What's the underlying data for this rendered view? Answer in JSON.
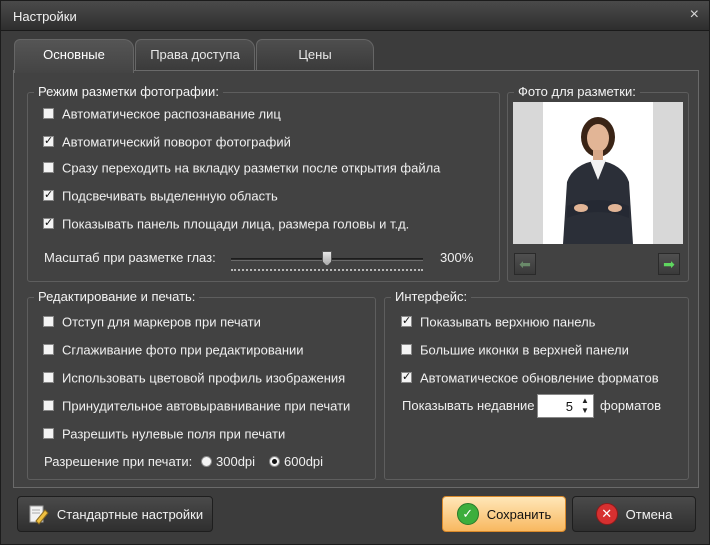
{
  "window": {
    "title": "Настройки",
    "close_glyph": "×"
  },
  "tabs": [
    {
      "label": "Основные",
      "active": true
    },
    {
      "label": "Права доступа",
      "active": false
    },
    {
      "label": "Цены",
      "active": false
    }
  ],
  "photo_markup": {
    "legend": "Режим разметки фотографии:",
    "options": [
      {
        "label": "Автоматическое распознавание лиц",
        "checked": false
      },
      {
        "label": "Автоматический поворот фотографий",
        "checked": true
      },
      {
        "label": "Сразу переходить на вкладку разметки после открытия файла",
        "checked": false
      },
      {
        "label": "Подсвечивать выделенную область",
        "checked": true
      },
      {
        "label": "Показывать панель площади лица, размера головы и т.д.",
        "checked": true
      }
    ],
    "scale_label": "Масштаб при разметке глаз:",
    "scale_value": "300%",
    "scale_level": 0.5
  },
  "photo_preview": {
    "legend": "Фото для разметки:",
    "prev_icon": "arrow-left-icon",
    "next_icon": "arrow-right-icon"
  },
  "editing": {
    "legend": "Редактирование и печать:",
    "options": [
      {
        "label": "Отступ для маркеров при печати",
        "checked": false
      },
      {
        "label": "Сглаживание фото при редактировании",
        "checked": false
      },
      {
        "label": "Использовать цветовой профиль изображения",
        "checked": false
      },
      {
        "label": "Принудительное автовыравнивание при печати",
        "checked": false
      },
      {
        "label": "Разрешить нулевые поля при печати",
        "checked": false
      }
    ],
    "resolution_label": "Разрешение при печати:",
    "resolution_options": [
      {
        "label": "300dpi",
        "selected": false
      },
      {
        "label": "600dpi",
        "selected": true
      }
    ]
  },
  "interface": {
    "legend": "Интерфейс:",
    "options": [
      {
        "label": "Показывать верхнюю панель",
        "checked": true
      },
      {
        "label": "Большие иконки в верхней панели",
        "checked": false
      },
      {
        "label": "Автоматическое обновление форматов",
        "checked": true
      }
    ],
    "recent_prefix": "Показывать недавние",
    "recent_value": "5",
    "recent_suffix": "форматов"
  },
  "buttons": {
    "defaults": "Стандартные настройки",
    "save": "Сохранить",
    "cancel": "Отмена"
  },
  "colors": {
    "window_bg": "#3c3c3c",
    "save_accent": "#f8b860",
    "ok_green": "#3cae3c",
    "cancel_red": "#d63030"
  }
}
